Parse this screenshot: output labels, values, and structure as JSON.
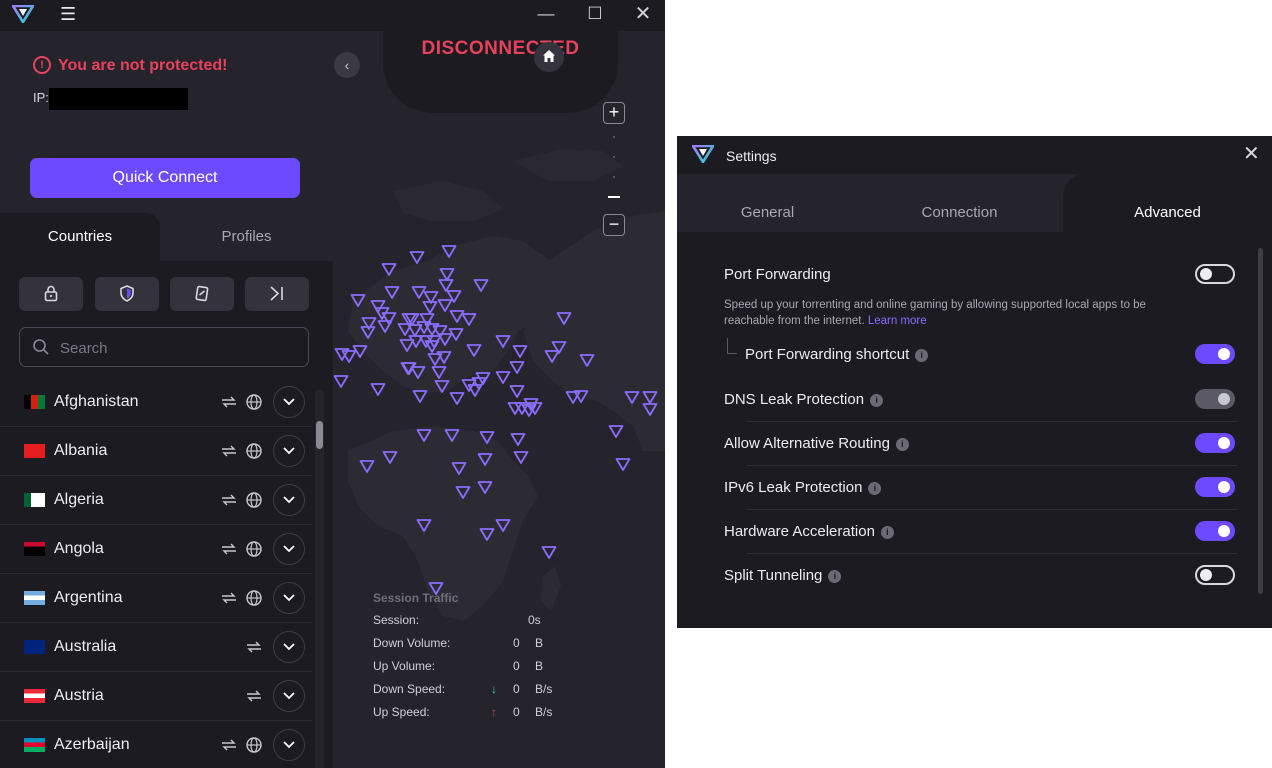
{
  "app": {
    "status_warning": "You are not protected!",
    "ip_label": "IP:",
    "quick_connect": "Quick Connect",
    "tabs": {
      "countries": "Countries",
      "profiles": "Profiles"
    },
    "search_placeholder": "Search",
    "connection_status": "DISCONNECTED",
    "icons": {
      "logo": "protonvpn-logo-icon",
      "menu": "hamburger-menu-icon",
      "minimize": "minimize-icon",
      "maximize": "maximize-icon",
      "close": "close-icon",
      "filters": [
        "lock-icon",
        "shield-icon",
        "secure-core-icon",
        "arrow-to-end-icon"
      ]
    },
    "countries": [
      {
        "name": "Afghanistan",
        "flag_colors": [
          "#000000",
          "#d32011",
          "#007a36"
        ],
        "globe": true
      },
      {
        "name": "Albania",
        "flag_colors": [
          "#e41e20",
          "#e41e20",
          "#e41e20"
        ],
        "globe": true
      },
      {
        "name": "Algeria",
        "flag_colors": [
          "#006233",
          "#ffffff",
          "#ffffff"
        ],
        "globe": true
      },
      {
        "name": "Angola",
        "flag_colors": [
          "#cc092f",
          "#000000",
          "#000000"
        ],
        "globe": true
      },
      {
        "name": "Argentina",
        "flag_colors": [
          "#74acdf",
          "#ffffff",
          "#74acdf"
        ],
        "globe": true
      },
      {
        "name": "Australia",
        "flag_colors": [
          "#00247d",
          "#00247d",
          "#00247d"
        ],
        "globe": false
      },
      {
        "name": "Austria",
        "flag_colors": [
          "#ed2939",
          "#ffffff",
          "#ed2939"
        ],
        "globe": false
      },
      {
        "name": "Azerbaijan",
        "flag_colors": [
          "#0092bc",
          "#e4002b",
          "#00af66"
        ],
        "globe": true
      }
    ],
    "traffic": {
      "title": "Session Traffic",
      "rows": [
        {
          "label": "Session:",
          "arrow": "",
          "value": "0s",
          "unit": ""
        },
        {
          "label": "Down Volume:",
          "arrow": "",
          "value": "0",
          "unit": "B"
        },
        {
          "label": "Up Volume:",
          "arrow": "",
          "value": "0",
          "unit": "B"
        },
        {
          "label": "Down Speed:",
          "arrow": "↓",
          "value": "0",
          "unit": "B/s"
        },
        {
          "label": "Up Speed:",
          "arrow": "↑",
          "value": "0",
          "unit": "B/s"
        }
      ]
    },
    "colors": {
      "accent": "#6d4aff",
      "danger": "#e8415c",
      "background": "#1c1b22",
      "panel": "#25242c"
    }
  },
  "settings": {
    "title": "Settings",
    "tabs": [
      "General",
      "Connection",
      "Advanced"
    ],
    "active_tab": "Advanced",
    "port_forwarding": {
      "label": "Port Forwarding",
      "enabled": false,
      "description": "Speed up your torrenting and online gaming by allowing supported local apps to be reachable from the internet.",
      "learn_more": "Learn more"
    },
    "items": [
      {
        "label": "Port Forwarding shortcut",
        "state": "on",
        "info": true
      },
      {
        "label": "DNS Leak Protection",
        "state": "disabled-on",
        "info": true
      },
      {
        "label": "Allow Alternative Routing",
        "state": "on",
        "info": true
      },
      {
        "label": "IPv6 Leak Protection",
        "state": "on",
        "info": true
      },
      {
        "label": "Hardware Acceleration",
        "state": "on",
        "info": true
      },
      {
        "label": "Split Tunneling",
        "state": "off",
        "info": true
      }
    ]
  }
}
